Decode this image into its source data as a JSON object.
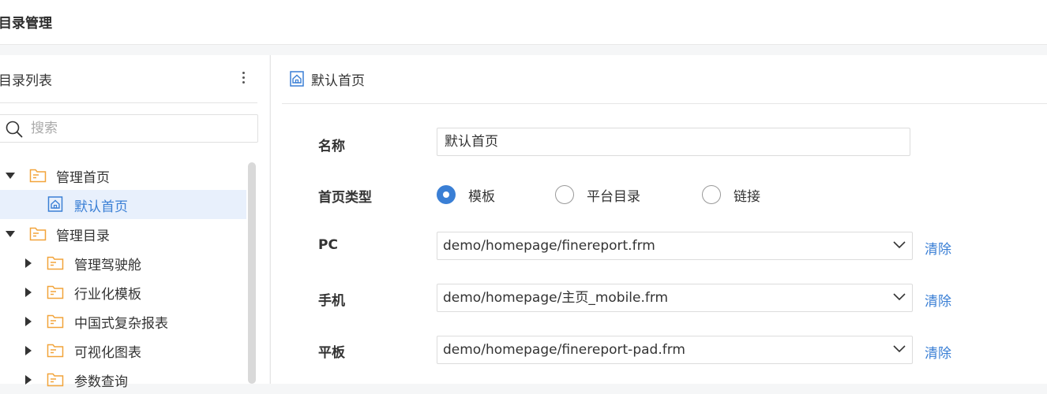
{
  "header": {
    "title": "目录管理"
  },
  "sidebar": {
    "title": "目录列表",
    "search_placeholder": "搜索",
    "tree": [
      {
        "label": "管理首页",
        "level": 0,
        "expanded": true,
        "type": "folder"
      },
      {
        "label": "默认首页",
        "level": 1,
        "type": "home",
        "selected": true
      },
      {
        "label": "管理目录",
        "level": 0,
        "expanded": true,
        "type": "folder"
      },
      {
        "label": "管理驾驶舱",
        "level": 1,
        "expanded": false,
        "type": "folder"
      },
      {
        "label": "行业化模板",
        "level": 1,
        "expanded": false,
        "type": "folder"
      },
      {
        "label": "中国式复杂报表",
        "level": 1,
        "expanded": false,
        "type": "folder"
      },
      {
        "label": "可视化图表",
        "level": 1,
        "expanded": false,
        "type": "folder"
      },
      {
        "label": "参数查询",
        "level": 1,
        "expanded": false,
        "type": "folder"
      }
    ]
  },
  "detail": {
    "title": "默认首页",
    "name_label": "名称",
    "name_value": "默认首页",
    "type_label": "首页类型",
    "type_options": [
      "模板",
      "平台目录",
      "链接"
    ],
    "type_selected": 0,
    "pc_label": "PC",
    "pc_value": "demo/homepage/finereport.frm",
    "mobile_label": "手机",
    "mobile_value": "demo/homepage/主页_mobile.frm",
    "pad_label": "平板",
    "pad_value": "demo/homepage/finereport-pad.frm",
    "clear_label": "清除"
  },
  "colors": {
    "accent": "#3a7fd5",
    "folder": "#f2a43a",
    "selected_bg": "#e8f0fc"
  }
}
